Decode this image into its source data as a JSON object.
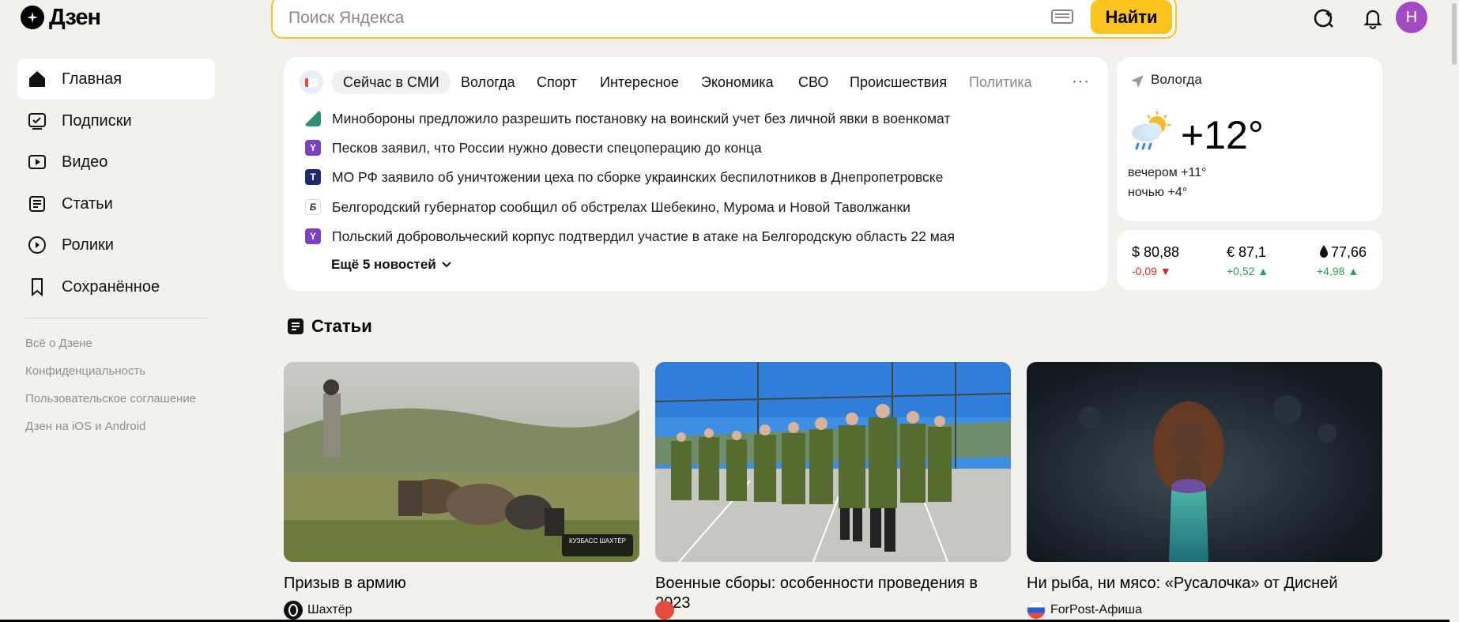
{
  "header": {
    "logo_text": "Дзен",
    "search_placeholder": "Поиск Яндекса",
    "search_button": "Найти",
    "avatar_letter": "Н",
    "icons": [
      "keyboard-icon",
      "alice-icon",
      "bell-icon"
    ]
  },
  "sidebar": {
    "items": [
      {
        "label": "Главная",
        "icon": "home-icon",
        "active": true
      },
      {
        "label": "Подписки",
        "icon": "subscriptions-icon"
      },
      {
        "label": "Видео",
        "icon": "video-icon"
      },
      {
        "label": "Статьи",
        "icon": "articles-icon"
      },
      {
        "label": "Ролики",
        "icon": "shorts-icon"
      },
      {
        "label": "Сохранённое",
        "icon": "bookmark-icon"
      }
    ],
    "links": [
      "Всё о Дзене",
      "Конфиденциальность",
      "Пользовательское соглашение",
      "Дзен на iOS и Android"
    ]
  },
  "news": {
    "tabs": [
      "Сейчас в СМИ",
      "Вологда",
      "Спорт",
      "Интересное",
      "Экономика",
      "СВО",
      "Происшествия",
      "Политика"
    ],
    "items": [
      {
        "text": "Минобороны предложило разрешить постановку на воинский учет без личной явки в военкомат",
        "source_icon": "source-icon",
        "color": "#2b8f7a"
      },
      {
        "text": "Песков заявил, что России нужно довести спецоперацию до конца",
        "source_icon": "source-icon",
        "color": "#7b3fbf"
      },
      {
        "text": "МО РФ заявило об уничтожении цеха по сборке украинских беспилотников в Днепропетровске",
        "source_icon": "source-icon",
        "color": "#1e2a6b"
      },
      {
        "text": "Белгородский губернатор сообщил об обстрелах Шебекино, Мурома и Новой Таволжанки",
        "source_icon": "source-icon",
        "color": "#ffffff"
      },
      {
        "text": "Польский добровольческий корпус подтвердил участие в атаке на Белгородскую область 22 мая",
        "source_icon": "source-icon",
        "color": "#7b3fbf"
      }
    ],
    "more": "Ещё 5 новостей"
  },
  "weather": {
    "city": "Вологда",
    "temp": "+12°",
    "evening": "вечером +11°",
    "night": "ночью +4°"
  },
  "rates": [
    {
      "value": "$ 80,88",
      "change": "-0,09",
      "dir": "down"
    },
    {
      "value": "€ 87,1",
      "change": "+0,52",
      "dir": "up"
    },
    {
      "value": "77,66",
      "change": "+4,98",
      "dir": "up"
    }
  ],
  "articles": {
    "section_title": "Статьи",
    "cards": [
      {
        "title": "Призыв в армию",
        "source": "Шахтёр",
        "watermark": "КУЗБАСС ШАХТЁР"
      },
      {
        "title": "Военные сборы: особенности проведения в 2023",
        "source": ""
      },
      {
        "title": "Ни рыба, ни мясо: «Русалочка» от Дисней",
        "source": "ForPost-Афиша"
      }
    ]
  },
  "colors": {
    "accent": "#fdc41f",
    "avatar": "#a44bc3",
    "down": "#e2262c",
    "up": "#27a552"
  }
}
